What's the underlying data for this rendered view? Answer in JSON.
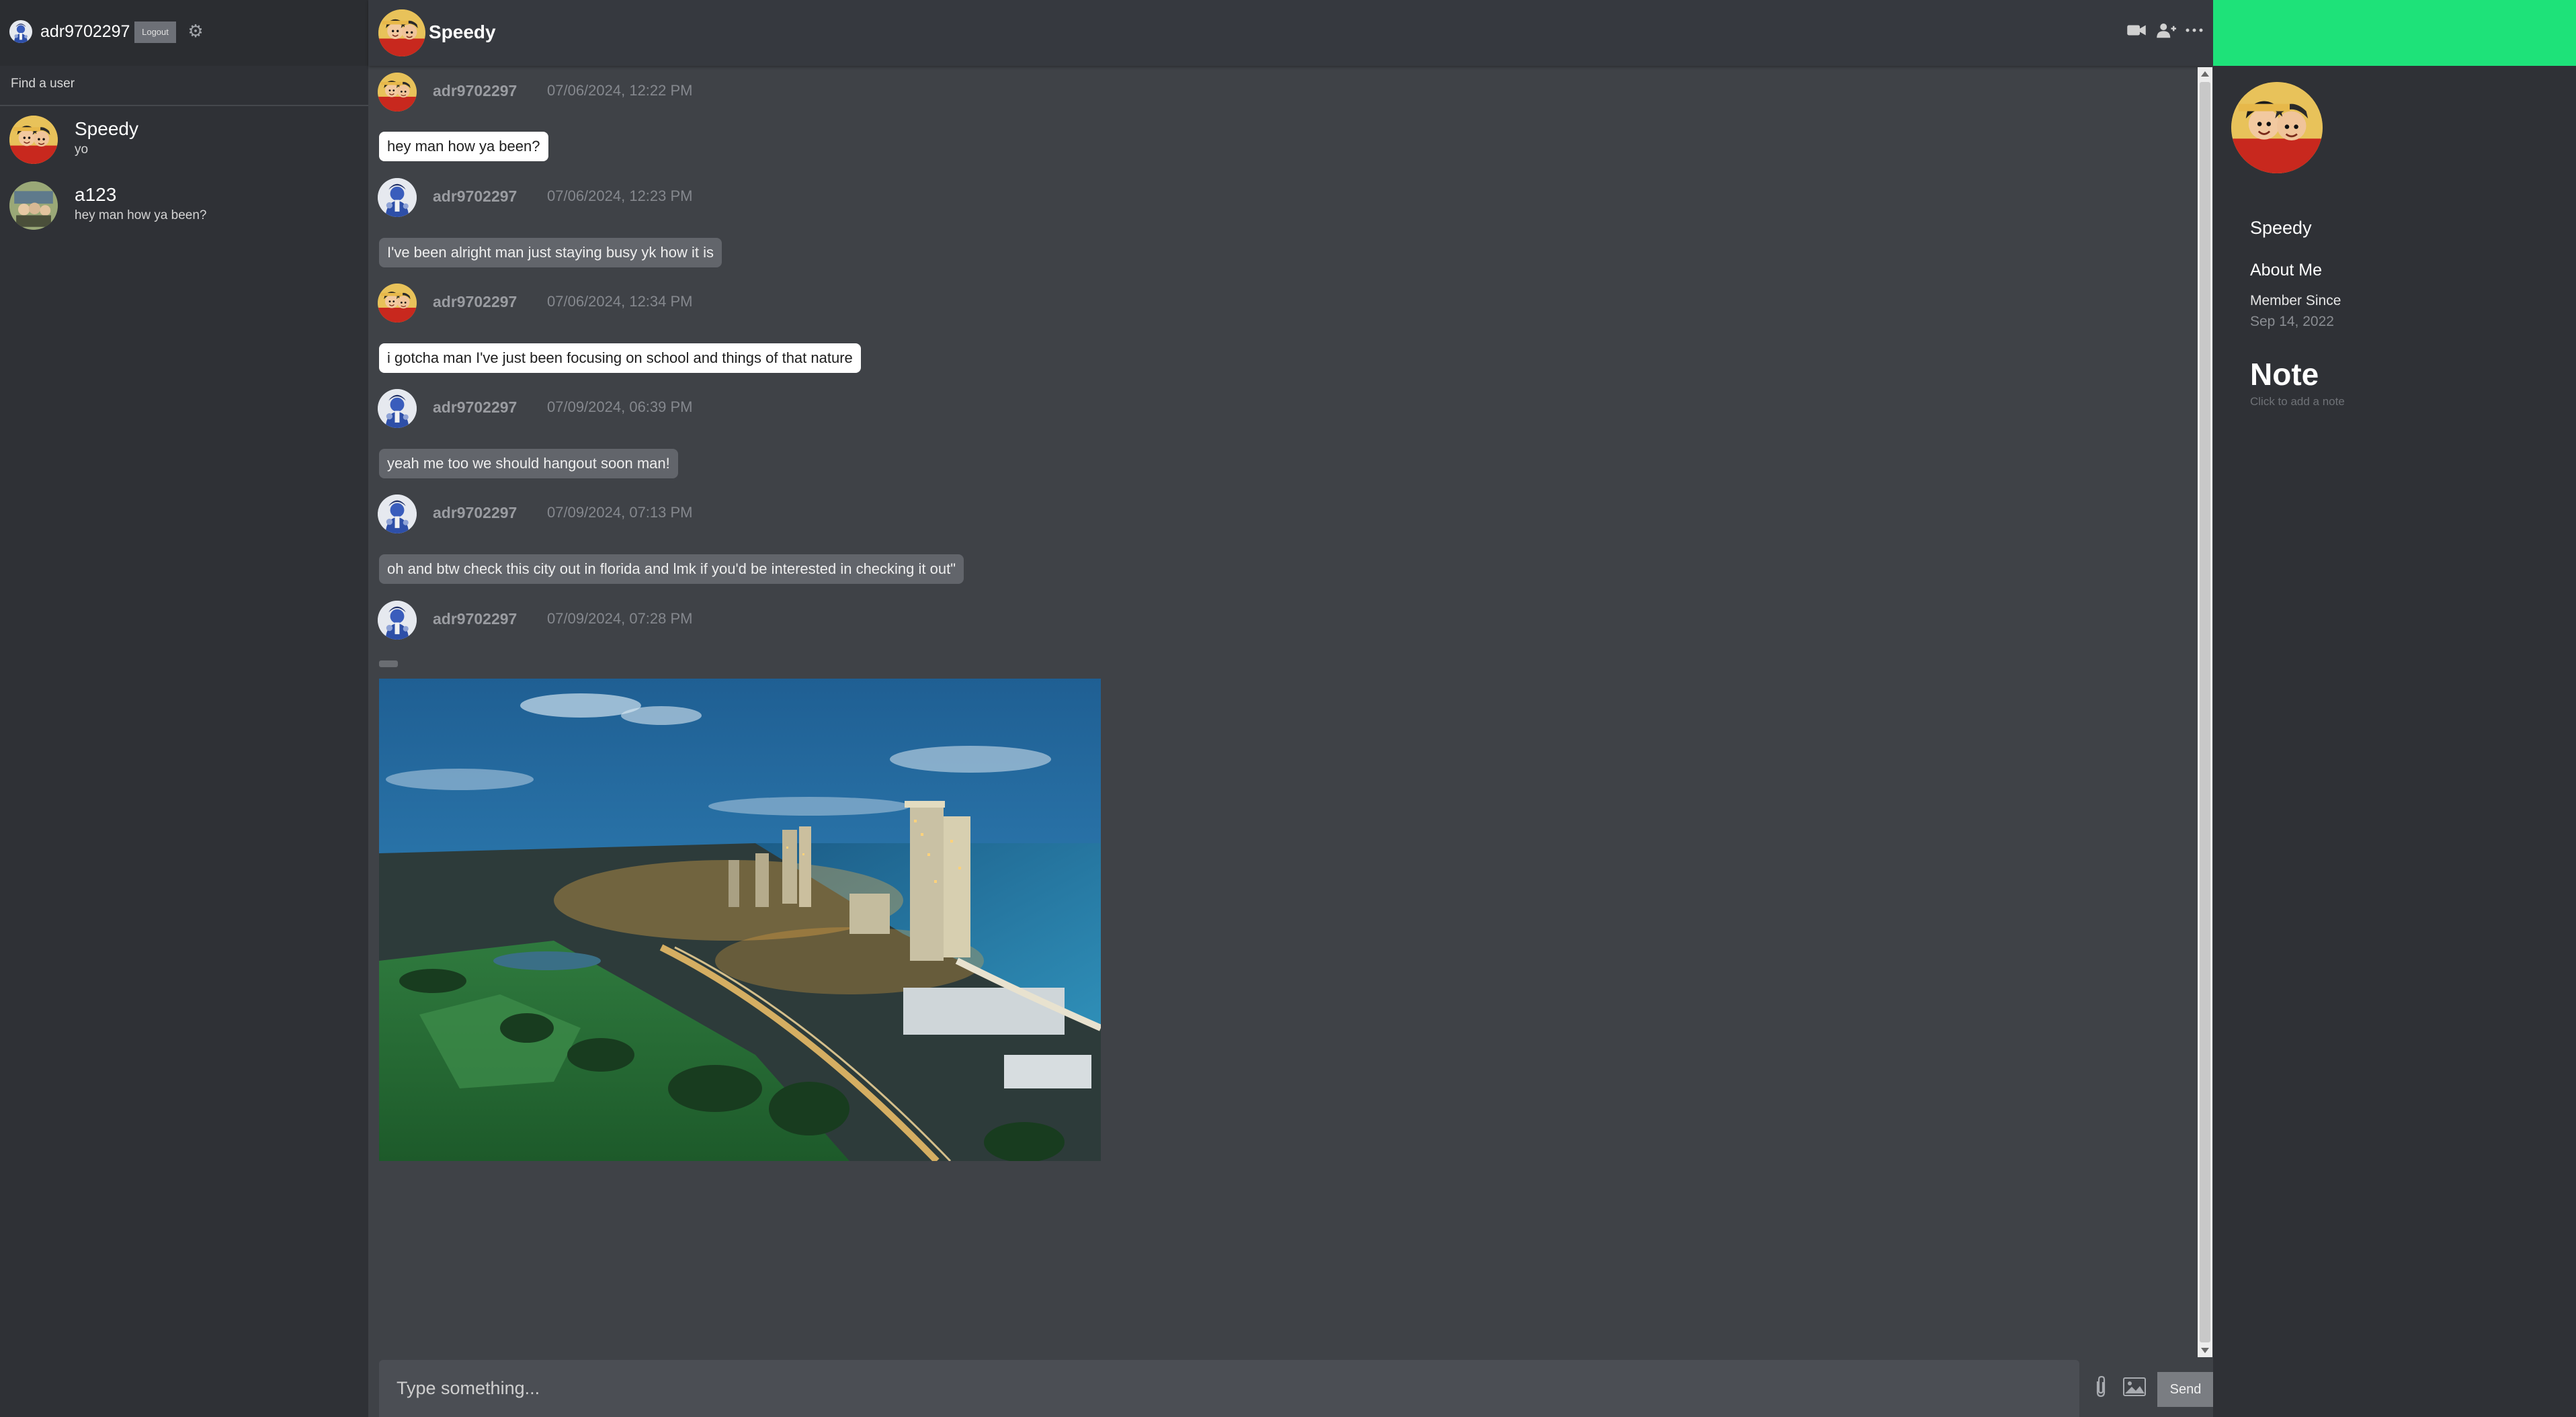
{
  "sidebar": {
    "username": "adr9702297",
    "logout_label": "Logout",
    "find_label": "Find a user",
    "contacts": [
      {
        "name": "Speedy",
        "preview": "yo"
      },
      {
        "name": "a123",
        "preview": "hey man how ya been?"
      }
    ]
  },
  "header": {
    "name": "Speedy"
  },
  "messages": [
    {
      "user": "adr9702297",
      "time": "07/06/2024, 12:22 PM",
      "text": "hey man how ya been?",
      "avatar": "luffy"
    },
    {
      "user": "adr9702297",
      "time": "07/06/2024, 12:23 PM",
      "text": "I've been alright man just staying busy yk how it is",
      "avatar": "blue"
    },
    {
      "user": "adr9702297",
      "time": "07/06/2024, 12:34 PM",
      "text": "i gotcha man I've just been focusing on school and things of that nature",
      "avatar": "luffy"
    },
    {
      "user": "adr9702297",
      "time": "07/09/2024, 06:39 PM",
      "text": "yeah me too we should hangout soon man!",
      "avatar": "blue"
    },
    {
      "user": "adr9702297",
      "time": "07/09/2024, 07:13 PM",
      "text": "oh and btw check this city out in florida and lmk if you'd be interested in checking it out\"",
      "avatar": "blue"
    },
    {
      "user": "adr9702297",
      "time": "07/09/2024, 07:28 PM",
      "text": "",
      "avatar": "blue",
      "image": "coastal city skyline at dusk"
    }
  ],
  "composer": {
    "placeholder": "Type something...",
    "send_label": "Send"
  },
  "profile": {
    "name": "Speedy",
    "about_label": "About Me",
    "member_since_label": "Member Since",
    "member_since_value": "Sep 14, 2022",
    "note_label": "Note",
    "note_hint": "Click to add a note",
    "banner_color": "#1ee279"
  }
}
